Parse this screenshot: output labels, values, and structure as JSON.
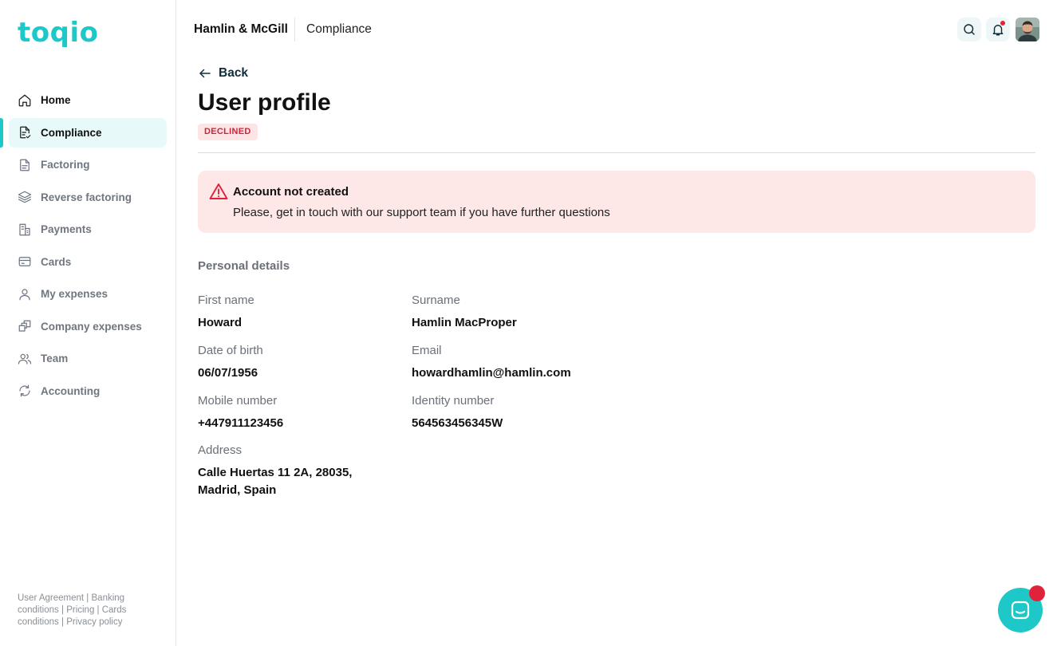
{
  "app": {
    "logo_text": "toqio",
    "brand_color": "#1ec8c8",
    "alert_color": "#e0233a"
  },
  "sidebar": {
    "items": [
      {
        "label": "Home",
        "icon": "home-icon",
        "active": false
      },
      {
        "label": "Compliance",
        "icon": "document-check-icon",
        "active": true
      },
      {
        "label": "Factoring",
        "icon": "document-icon",
        "active": false
      },
      {
        "label": "Reverse factoring",
        "icon": "layers-icon",
        "active": false
      },
      {
        "label": "Payments",
        "icon": "payments-icon",
        "active": false
      },
      {
        "label": "Cards",
        "icon": "card-icon",
        "active": false
      },
      {
        "label": "My expenses",
        "icon": "user-icon",
        "active": false
      },
      {
        "label": "Company expenses",
        "icon": "stacked-squares-icon",
        "active": false
      },
      {
        "label": "Team",
        "icon": "team-icon",
        "active": false
      },
      {
        "label": "Accounting",
        "icon": "sync-icon",
        "active": false
      }
    ],
    "footer_links": [
      "User Agreement",
      "Banking conditions",
      "Pricing",
      "Cards conditions",
      "Privacy policy"
    ],
    "footer_separator": " | "
  },
  "topbar": {
    "company": "Hamlin & McGill",
    "section": "Compliance",
    "icons": [
      "search-icon",
      "bell-icon"
    ]
  },
  "page": {
    "back_label": "Back",
    "title": "User profile",
    "status_badge": "DECLINED",
    "alert": {
      "title": "Account not created",
      "message": "Please, get in touch with our support team if you have further questions"
    },
    "section_heading": "Personal details",
    "fields": {
      "first_name": {
        "label": "First name",
        "value": "Howard"
      },
      "surname": {
        "label": "Surname",
        "value": "Hamlin MacProper"
      },
      "dob": {
        "label": "Date of birth",
        "value": "06/07/1956"
      },
      "email": {
        "label": "Email",
        "value": "howardhamlin@hamlin.com"
      },
      "mobile": {
        "label": "Mobile number",
        "value": "+447911123456"
      },
      "identity": {
        "label": "Identity number",
        "value": "564563456345W"
      },
      "address": {
        "label": "Address",
        "value_line1": "Calle Huertas 11 2A, 28035,",
        "value_line2": "Madrid, Spain"
      }
    }
  }
}
